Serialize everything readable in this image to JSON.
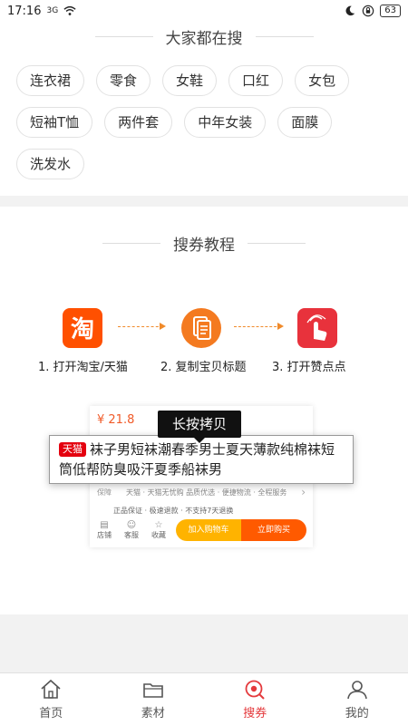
{
  "status_bar": {
    "time": "17:16",
    "network": "3G",
    "battery": "63"
  },
  "hot_search": {
    "title": "大家都在搜",
    "tags": [
      "连衣裙",
      "零食",
      "女鞋",
      "口红",
      "女包",
      "短袖T恤",
      "两件套",
      "中年女装",
      "面膜",
      "洗发水"
    ]
  },
  "tutorial": {
    "title": "搜券教程",
    "steps": [
      {
        "label": "1. 打开淘宝/天猫",
        "icon": "taobao-app-icon",
        "color": "#ff5000",
        "glyph": "淘"
      },
      {
        "label": "2. 复制宝贝标题",
        "icon": "copy-document-icon",
        "color": "#f47a20"
      },
      {
        "label": "3. 打开赞点点",
        "icon": "tap-hand-icon",
        "color": "#e8323c"
      }
    ],
    "mock_product": {
      "price": "¥ 21.8",
      "tooltip": "长按拷贝",
      "badge": "天猫",
      "title": "袜子男短袜潮春季男士夏天薄款纯棉袜短筒低帮防臭吸汗夏季船袜男",
      "guarantee_label": "保障",
      "guarantee_text": "天猫 · 天猫无忧购  品质优选 · 便捷物流 · 全程服务",
      "shipping": "正品保证 · 极速退款 · 不支持7天退换",
      "shop": "店铺",
      "service": "客服",
      "favorite": "收藏",
      "add_cart": "加入购物车",
      "buy_now": "立即购买"
    }
  },
  "bottom_nav": [
    {
      "label": "首页",
      "icon": "home-icon"
    },
    {
      "label": "素材",
      "icon": "folder-icon"
    },
    {
      "label": "搜券",
      "icon": "search-coupon-icon",
      "active": true
    },
    {
      "label": "我的",
      "icon": "user-icon"
    }
  ],
  "colors": {
    "accent": "#e4393c",
    "tmall": "#e4000f",
    "orange": "#f08a2a"
  }
}
